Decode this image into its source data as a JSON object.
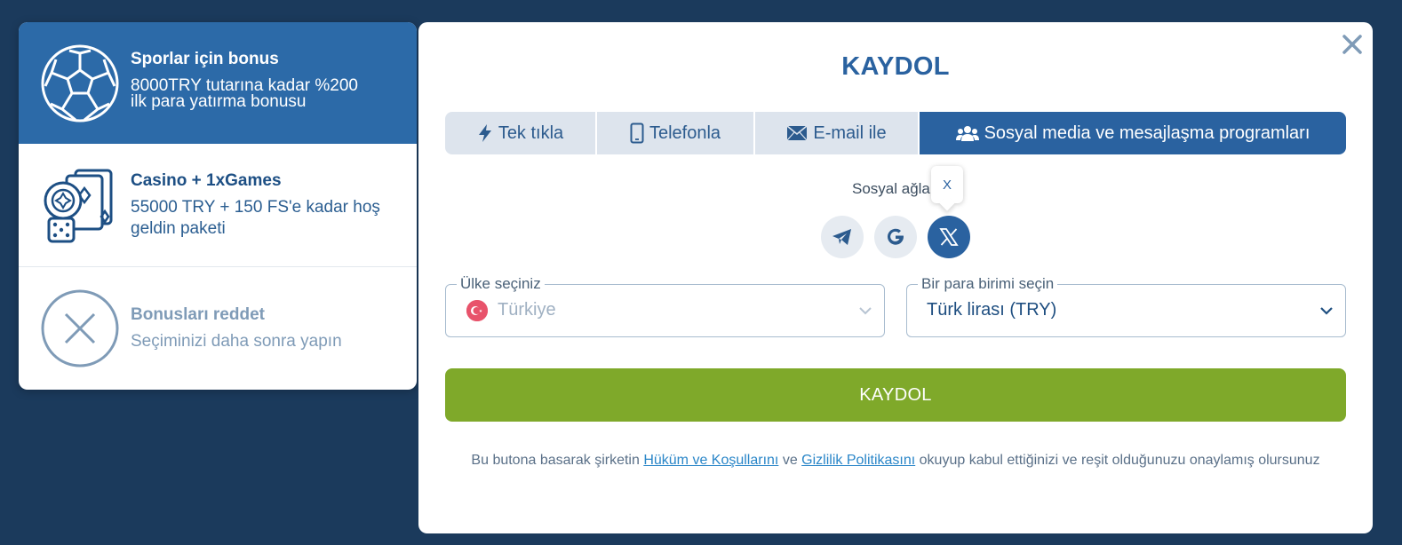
{
  "bonus_panel": {
    "items": [
      {
        "title": "Sporlar için bonus",
        "desc_line1": "8000TRY tutarına kadar %200",
        "desc_line2": "ilk para yatırma bonusu"
      },
      {
        "title": "Casino + 1xGames",
        "desc_line1": "55000 TRY + 150 FS'e kadar hoş",
        "desc_line2": "geldin paketi"
      },
      {
        "title": "Bonusları reddet",
        "desc_line1": "Seçiminizi daha sonra yapın"
      }
    ]
  },
  "modal": {
    "title": "KAYDOL",
    "tabs": [
      {
        "label": "Tek tıkla"
      },
      {
        "label": "Telefonla"
      },
      {
        "label": "E-mail ile"
      },
      {
        "label": "Sosyal media ve mesajlaşma programları"
      }
    ],
    "social_label": "Sosyal ağla",
    "tooltip": "X",
    "country_field": {
      "legend": "Ülke seçiniz",
      "value": "Türkiye"
    },
    "currency_field": {
      "legend": "Bir para birimi seçin",
      "value": "Türk lirası (TRY)"
    },
    "submit_label": "KAYDOL",
    "terms": {
      "part1": "Bu butona basarak şirketin ",
      "link1": "Hüküm ve Koşullarını",
      "part2": " ve ",
      "link2": "Gizlilik Politikasını",
      "part3": " okuyup kabul ettiğinizi ve reşit olduğunuzu onaylamış olursunuz"
    }
  },
  "colors": {
    "background": "#1b3a5c",
    "primary_blue": "#2a62a0",
    "submit_green": "#7fa92a",
    "link_blue": "#2a86c8"
  },
  "icons": {
    "sports": "soccer-ball-icon",
    "casino": "casino-chips-cards-icon",
    "reject": "x-circle-icon",
    "close": "close-icon",
    "tab1": "lightning-icon",
    "tab2": "phone-icon",
    "tab3": "envelope-icon",
    "tab4": "users-group-icon",
    "social": [
      "telegram-icon",
      "google-icon",
      "x-logo-icon"
    ]
  }
}
